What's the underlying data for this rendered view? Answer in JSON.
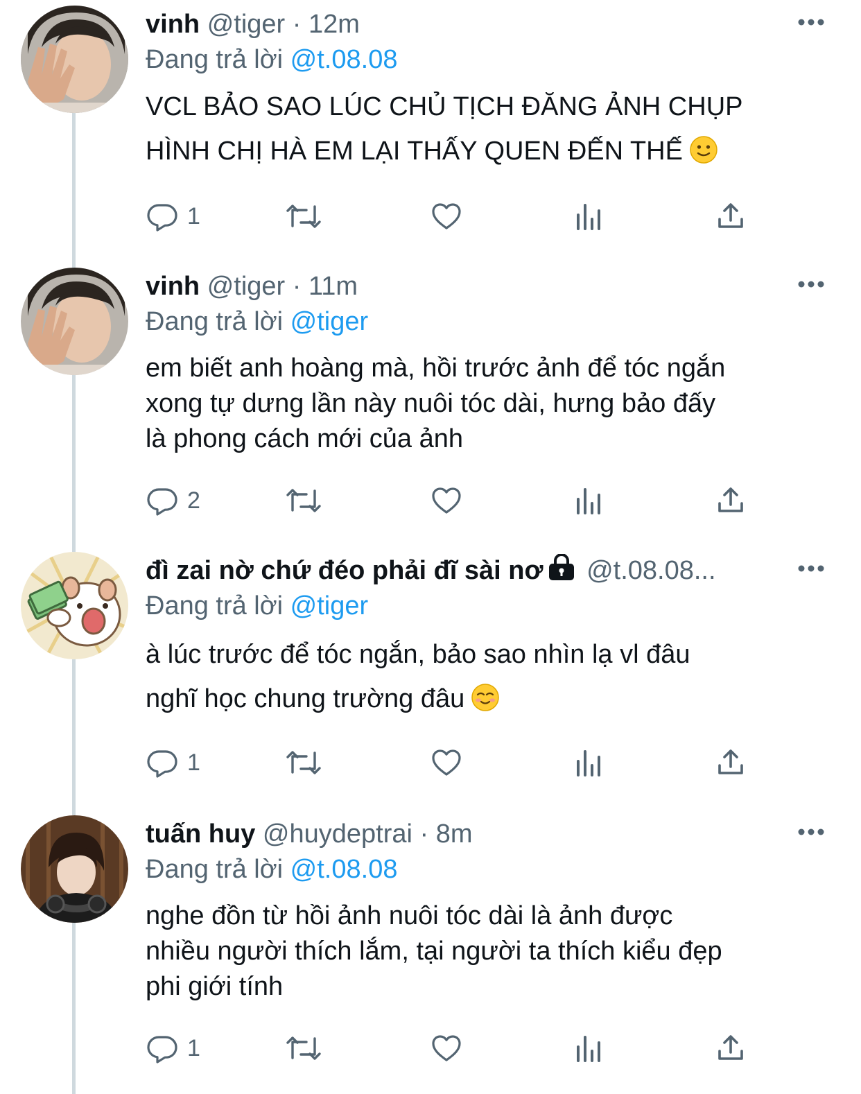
{
  "tweets": [
    {
      "name": "vinh",
      "handle": "@tiger",
      "separator": "·",
      "time": "12m",
      "locked": false,
      "replying_prefix": "Đang trả lời",
      "replying_to": "@t.08.08",
      "text": "VCL BẢO SAO LÚC CHỦ TỊCH ĐĂNG ẢNH CHỤP\nHÌNH CHỊ HÀ EM LẠI THẤY QUEN ĐẾN THẾ",
      "emoji": "slightly-smiling-face",
      "reply_count": "1",
      "avatar": "boy-hand-over-face"
    },
    {
      "name": "vinh",
      "handle": "@tiger",
      "separator": "·",
      "time": "11m",
      "locked": false,
      "replying_prefix": "Đang trả lời",
      "replying_to": "@tiger",
      "text": "em biết anh hoàng mà, hồi trước ảnh để tóc ngắn\nxong tự dưng lần này nuôi tóc dài, hưng bảo đấy\nlà phong cách mới của ảnh",
      "emoji": "",
      "reply_count": "2",
      "avatar": "boy-hand-over-face"
    },
    {
      "name": "đì zai nờ chứ đéo phải đĩ sài nơ",
      "handle": "@t.08.08...",
      "separator": "",
      "time": "",
      "locked": true,
      "replying_prefix": "Đang trả lời",
      "replying_to": "@tiger",
      "text": "à lúc trước để tóc ngắn, bảo sao nhìn lạ vl đâu\nnghĩ học chung trường đâu",
      "emoji": "smiling-face",
      "reply_count": "1",
      "avatar": "cartoon-dog-with-money"
    },
    {
      "name": "tuấn huy",
      "handle": "@huydeptrai",
      "separator": "·",
      "time": "8m",
      "locked": false,
      "replying_prefix": "Đang trả lời",
      "replying_to": "@t.08.08",
      "text": "nghe đồn từ hồi ảnh nuôi tóc dài là ảnh được\nnhiều người thích lắm, tại người ta thích kiểu đẹp\nphi giới tính",
      "emoji": "",
      "reply_count": "1",
      "avatar": "man-with-headphones"
    }
  ],
  "icons": {
    "reply": "reply-icon",
    "retweet": "retweet-icon",
    "like": "heart-icon",
    "views": "views-icon",
    "share": "share-icon",
    "more": "more-icon"
  },
  "colors": {
    "link": "#1d9bf0",
    "secondary": "#536471",
    "thread_line": "#cfd9de"
  }
}
